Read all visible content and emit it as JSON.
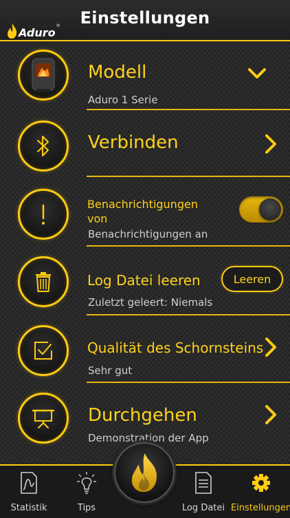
{
  "header": {
    "title": "Einstellungen",
    "logo_text": "Aduro",
    "logo_reg": "®"
  },
  "settings": {
    "modell": {
      "label": "Modell",
      "value": "Aduro 1 Serie"
    },
    "verbinden": {
      "label": "Verbinden"
    },
    "benachrichtigungen": {
      "label_line1": "Benachrichtigungen",
      "label_line2": "von",
      "status": "Benachrichtigungen an",
      "enabled": true
    },
    "log": {
      "label": "Log Datei leeren",
      "status": "Zuletzt geleert: Niemals",
      "button_label": "Leeren"
    },
    "schornstein": {
      "label": "Qualität des Schornsteins",
      "value": "Sehr gut"
    },
    "durchgehen": {
      "label": "Durchgehen",
      "description": "Demonstration der App"
    }
  },
  "tabbar": {
    "tabs": [
      {
        "label": "Statistik",
        "active": false
      },
      {
        "label": "Tips",
        "active": false
      },
      {
        "label": "Log Datei",
        "active": false
      },
      {
        "label": "Einstellungen",
        "active": true
      }
    ]
  },
  "colors": {
    "accent": "#ffcc11",
    "background": "#2a2a2a",
    "subtext": "#cfcfcf"
  }
}
